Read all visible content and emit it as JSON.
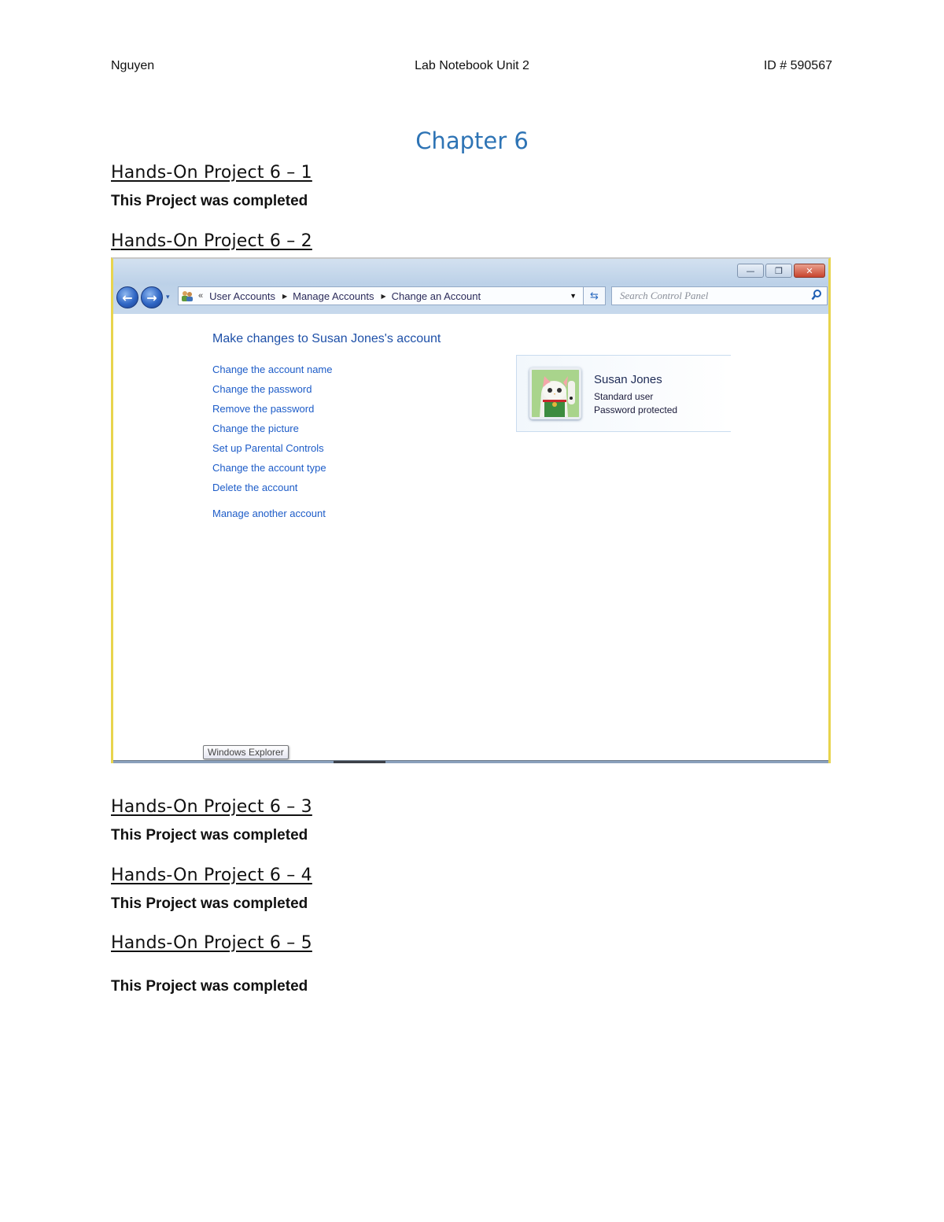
{
  "header": {
    "left": "Nguyen",
    "center": "Lab Notebook Unit 2",
    "right": "ID # 590567"
  },
  "chapter_title": "Chapter 6",
  "projects": [
    {
      "title": "Hands-On Project 6 – 1",
      "status": "This Project was completed"
    },
    {
      "title": "Hands-On Project 6 – 2"
    },
    {
      "title": "Hands-On Project 6 – 3",
      "status": "This Project was completed"
    },
    {
      "title": "Hands-On Project 6 – 4",
      "status": "This Project was completed"
    },
    {
      "title": "Hands-On Project 6 – 5",
      "status": "This Project was completed"
    }
  ],
  "screenshot": {
    "caption_buttons": {
      "minimize": "—",
      "restore": "❐",
      "close": "✕"
    },
    "nav": {
      "back_icon": "←",
      "forward_icon": "→",
      "dropdown_icon": "▾"
    },
    "address": {
      "overflow": "«",
      "breadcrumbs": [
        "User Accounts",
        "Manage Accounts",
        "Change an Account"
      ],
      "separator": "▶",
      "dropdown_icon": "▼",
      "refresh_icon": "⇆"
    },
    "search": {
      "placeholder": "Search Control Panel",
      "icon": "⚲"
    },
    "content": {
      "heading": "Make changes to Susan Jones's account",
      "links": [
        "Change the account name",
        "Change the password",
        "Remove the password",
        "Change the picture",
        "Set up Parental Controls",
        "Change the account type",
        "Delete the account"
      ],
      "extra_link": "Manage another account"
    },
    "user": {
      "name": "Susan Jones",
      "type": "Standard user",
      "status": "Password protected"
    },
    "tooltip": "Windows Explorer"
  }
}
